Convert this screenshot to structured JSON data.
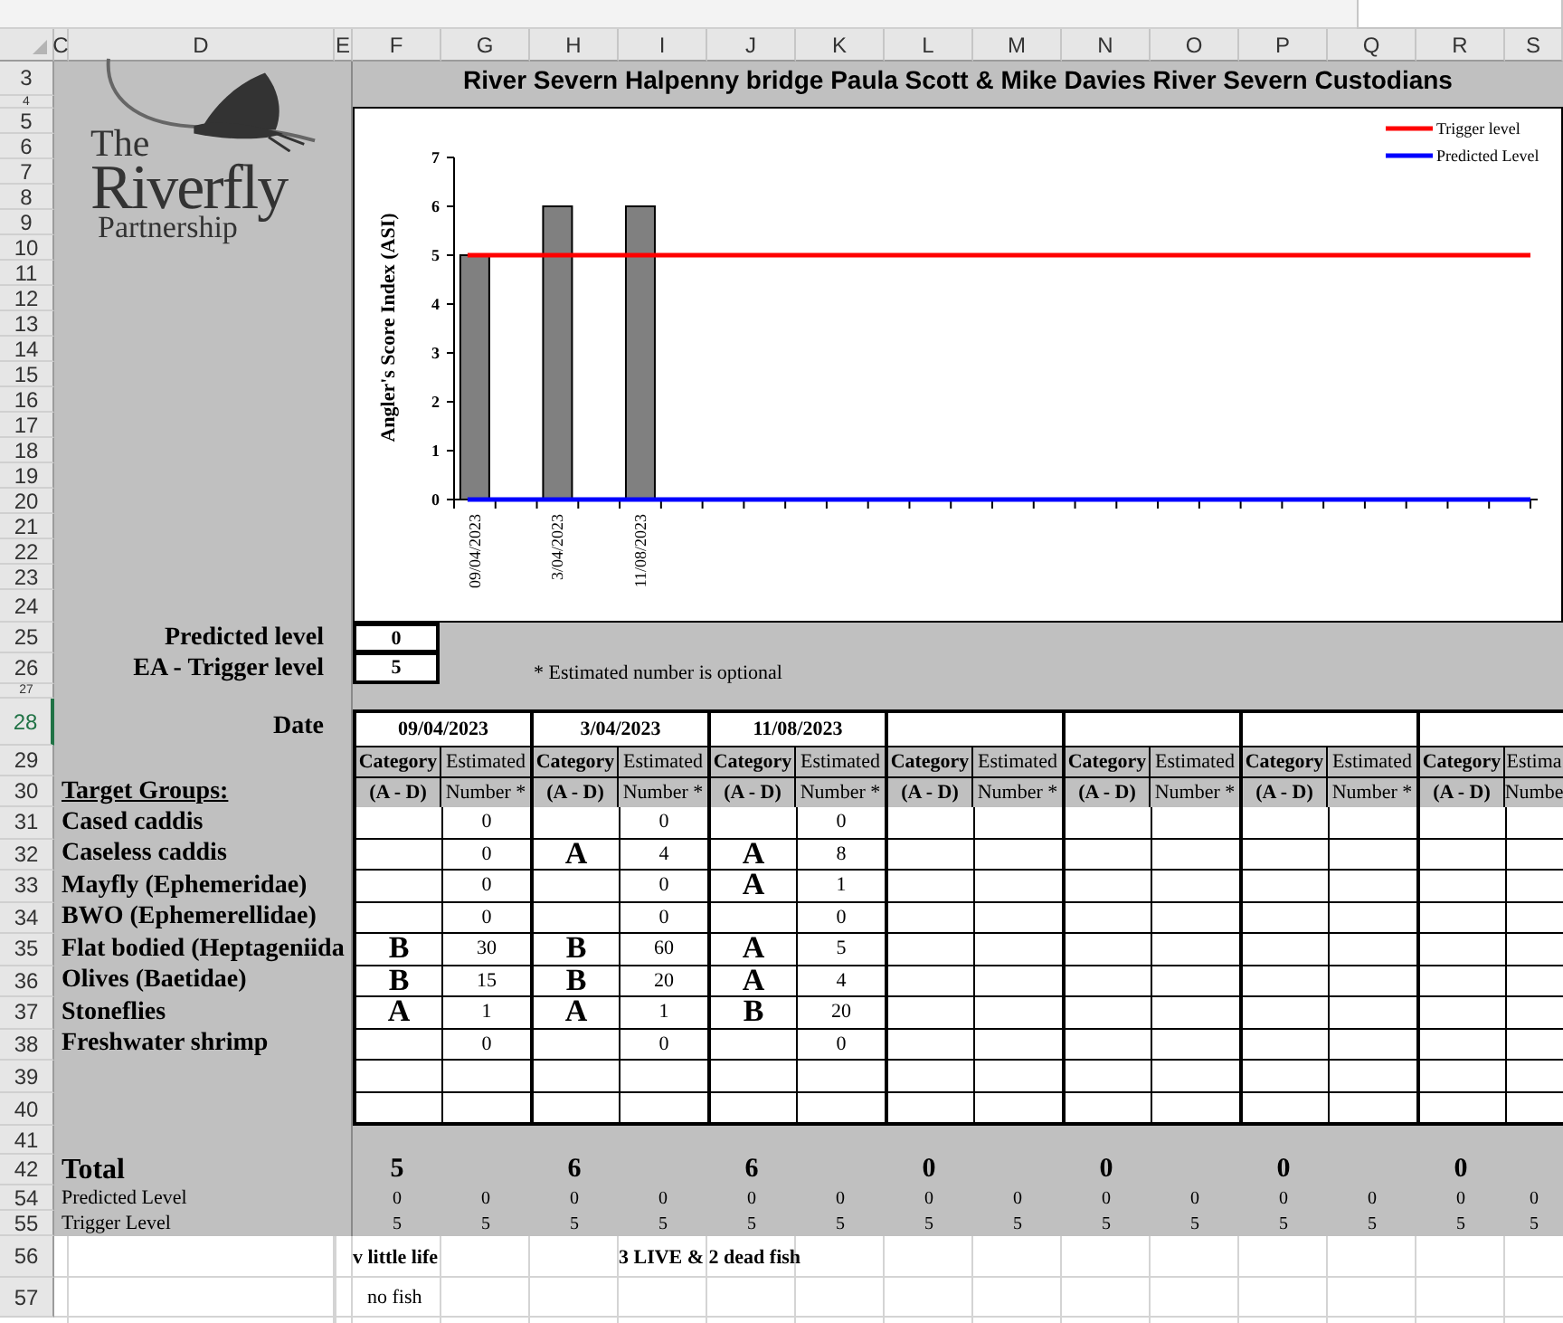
{
  "column_headers": [
    "C",
    "D",
    "E",
    "F",
    "G",
    "H",
    "I",
    "J",
    "K",
    "L",
    "M",
    "N",
    "O",
    "P",
    "Q",
    "R",
    "S"
  ],
  "row_numbers": [
    {
      "label": "3",
      "selected": false
    },
    {
      "label": "4",
      "selected": false
    },
    {
      "label": "5",
      "selected": false
    },
    {
      "label": "6",
      "selected": false
    },
    {
      "label": "7",
      "selected": false
    },
    {
      "label": "8",
      "selected": false
    },
    {
      "label": "9",
      "selected": false
    },
    {
      "label": "10",
      "selected": false
    },
    {
      "label": "11",
      "selected": false
    },
    {
      "label": "12",
      "selected": false
    },
    {
      "label": "13",
      "selected": false
    },
    {
      "label": "14",
      "selected": false
    },
    {
      "label": "15",
      "selected": false
    },
    {
      "label": "16",
      "selected": false
    },
    {
      "label": "17",
      "selected": false
    },
    {
      "label": "18",
      "selected": false
    },
    {
      "label": "19",
      "selected": false
    },
    {
      "label": "20",
      "selected": false
    },
    {
      "label": "21",
      "selected": false
    },
    {
      "label": "22",
      "selected": false
    },
    {
      "label": "23",
      "selected": false
    },
    {
      "label": "24",
      "selected": false
    },
    {
      "label": "25",
      "selected": false
    },
    {
      "label": "26",
      "selected": false
    },
    {
      "label": "27",
      "selected": false
    },
    {
      "label": "28",
      "selected": true
    },
    {
      "label": "29",
      "selected": false
    },
    {
      "label": "30",
      "selected": false
    },
    {
      "label": "31",
      "selected": false
    },
    {
      "label": "32",
      "selected": false
    },
    {
      "label": "33",
      "selected": false
    },
    {
      "label": "34",
      "selected": false
    },
    {
      "label": "35",
      "selected": false
    },
    {
      "label": "36",
      "selected": false
    },
    {
      "label": "37",
      "selected": false
    },
    {
      "label": "38",
      "selected": false
    },
    {
      "label": "39",
      "selected": false
    },
    {
      "label": "40",
      "selected": false
    },
    {
      "label": "41",
      "selected": false
    },
    {
      "label": "42",
      "selected": false
    },
    {
      "label": "54",
      "selected": false
    },
    {
      "label": "55",
      "selected": false
    },
    {
      "label": "56",
      "selected": false
    },
    {
      "label": "57",
      "selected": false
    }
  ],
  "title": "River Severn Halpenny bridge Paula Scott & Mike Davies River Severn Custodians",
  "logo": {
    "lines": [
      "The",
      "Riverfly",
      "Partnership"
    ]
  },
  "chart": {
    "chart_data": {
      "type": "bar",
      "ylabel": "Angler's Score Index (ASI)",
      "ylim": [
        0,
        7
      ],
      "yticks": [
        0,
        1,
        2,
        3,
        4,
        5,
        6,
        7
      ],
      "categories": [
        "09/04/2023",
        "3/04/2023",
        "11/08/2023"
      ],
      "legend": "top-right",
      "series": [
        {
          "type": "bar",
          "color": "#808080",
          "values": [
            5,
            6,
            6
          ]
        },
        {
          "type": "line",
          "name": "Trigger level",
          "color": "#ff0000",
          "values": [
            5,
            5,
            5
          ]
        },
        {
          "type": "line",
          "name": "Predicted Level",
          "color": "#0000ff",
          "values": [
            0,
            0,
            0
          ]
        }
      ]
    }
  },
  "levels": [
    {
      "label": "Predicted level",
      "value": "0"
    },
    {
      "label": "EA - Trigger level",
      "value": "5"
    }
  ],
  "note": "* Estimated number is optional",
  "table": {
    "date_label": "Date",
    "groups_label": "Target Groups:",
    "sessions": [
      {
        "date": "09/04/2023",
        "category_header": [
          "Category",
          "(A - D)"
        ],
        "number_header": [
          "Estimated",
          "Number *"
        ]
      },
      {
        "date": "3/04/2023",
        "category_header": [
          "Category",
          "(A - D)"
        ],
        "number_header": [
          "Estimated",
          "Number *"
        ]
      },
      {
        "date": "11/08/2023",
        "category_header": [
          "Category",
          "(A - D)"
        ],
        "number_header": [
          "Estimated",
          "Number *"
        ]
      },
      {
        "category_header": [
          "Category",
          "(A - D)"
        ],
        "number_header": [
          "Estimated",
          "Number *"
        ]
      },
      {
        "category_header": [
          "Category",
          "(A - D)"
        ],
        "number_header": [
          "Estimated",
          "Number *"
        ]
      },
      {
        "category_header": [
          "Category",
          "(A - D)"
        ],
        "number_header": [
          "Estimated",
          "Number *"
        ]
      },
      {
        "category_header": [
          "Category",
          "(A - D)"
        ],
        "number_header": [
          "Estima",
          "Numbe"
        ]
      }
    ],
    "rows": [
      {
        "name": "Cased caddis",
        "cells": [
          null,
          "0",
          null,
          "0",
          null,
          "0"
        ]
      },
      {
        "name": "Caseless caddis",
        "cells": [
          null,
          "0",
          "A",
          "4",
          "A",
          "8"
        ]
      },
      {
        "name": "Mayfly (Ephemeridae)",
        "cells": [
          null,
          "0",
          null,
          "0",
          "A",
          "1"
        ]
      },
      {
        "name": "BWO (Ephemerellidae)",
        "cells": [
          null,
          "0",
          null,
          "0",
          null,
          "0"
        ]
      },
      {
        "name": "Flat bodied (Heptageniida",
        "cells": [
          "B",
          "30",
          "B",
          "60",
          "A",
          "5"
        ]
      },
      {
        "name": "Olives (Baetidae)",
        "cells": [
          "B",
          "15",
          "B",
          "20",
          "A",
          "4"
        ]
      },
      {
        "name": "Stoneflies",
        "cells": [
          "A",
          "1",
          "A",
          "1",
          "B",
          "20"
        ]
      },
      {
        "name": "Freshwater shrimp",
        "cells": [
          null,
          "0",
          null,
          "0",
          null,
          "0"
        ]
      }
    ],
    "total": {
      "label": "Total",
      "values": [
        "5",
        "6",
        "6",
        "0",
        "0",
        "0",
        "0"
      ]
    },
    "predicted": {
      "label": "Predicted Level",
      "values": [
        "0",
        "0",
        "0",
        "0",
        "0",
        "0",
        "0",
        "0",
        "0",
        "0",
        "0",
        "0",
        "0",
        "0"
      ]
    },
    "trigger": {
      "label": "Trigger Level",
      "values": [
        "5",
        "5",
        "5",
        "5",
        "5",
        "5",
        "5",
        "5",
        "5",
        "5",
        "5",
        "5",
        "5",
        "5"
      ]
    }
  },
  "comments": [
    [
      "v little life",
      "3 LIVE & 2 dead fish"
    ],
    [
      "no fish"
    ]
  ]
}
